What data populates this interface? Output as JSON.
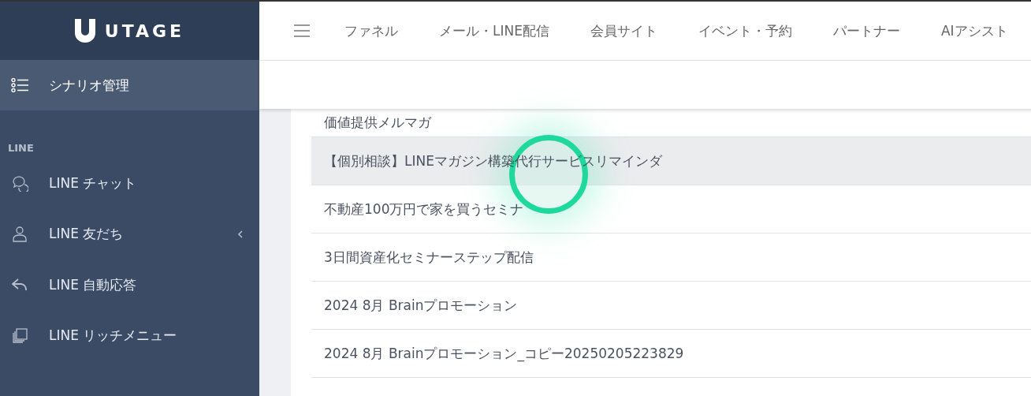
{
  "sidebar": {
    "logo": "UTAGE",
    "current": {
      "label": "シナリオ管理",
      "selected": true
    },
    "section": "LINE",
    "items": [
      {
        "label": "LINE チャット",
        "kind": "chat",
        "expandable": false
      },
      {
        "label": "LINE 友だち",
        "kind": "person",
        "expandable": true
      },
      {
        "label": "LINE 自動応答",
        "kind": "reply",
        "expandable": false
      },
      {
        "label": "LINE リッチメニュー",
        "kind": "layers",
        "expandable": false
      }
    ]
  },
  "top_nav": {
    "items": [
      "ファネル",
      "メール・LINE配信",
      "会員サイト",
      "イベント・予約",
      "パートナー",
      "AIアシスト"
    ]
  },
  "scenario_list": [
    {
      "name": "価値提供メルマガ",
      "selected": false
    },
    {
      "name": "【個別相談】LINEマガジン構築代行サービスリマインダ",
      "selected": true
    },
    {
      "name": "不動産100万円で家を買うセミナ",
      "selected": false
    },
    {
      "name": "3日間資産化セミナーステップ配信",
      "selected": false
    },
    {
      "name": "2024 8月 Brainプロモーション",
      "selected": false
    },
    {
      "name": "2024 8月 Brainプロモーション_コピー20250205223829",
      "selected": false
    }
  ],
  "click_indicator": {
    "shown": true
  }
}
